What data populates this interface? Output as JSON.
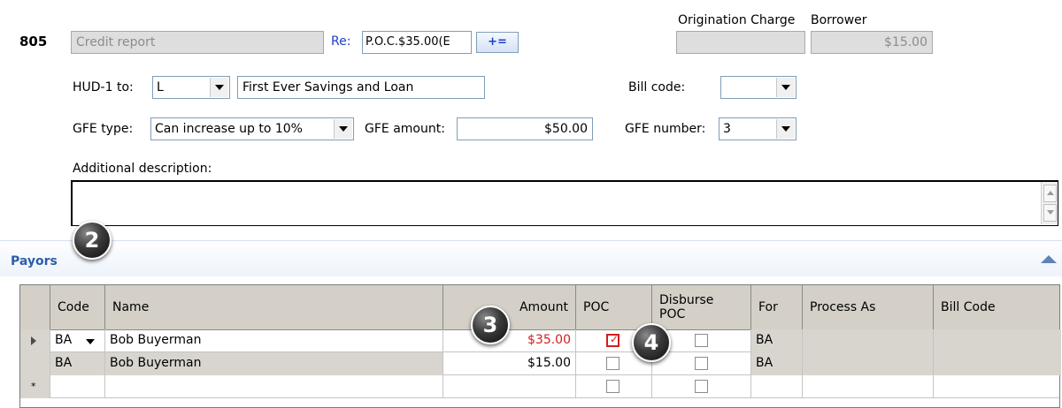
{
  "line": {
    "number": "805",
    "description": "Credit report",
    "re_label": "Re:",
    "re_value": "P.O.C.$35.00(E",
    "re_button": "+=",
    "origination_header": "Origination Charge",
    "borrower_header": "Borrower",
    "origination_value": "",
    "borrower_value": "$15.00"
  },
  "hud": {
    "label": "HUD-1 to:",
    "code": "L",
    "name": "First Ever Savings and Loan"
  },
  "bill": {
    "label": "Bill code:",
    "value": ""
  },
  "gfe": {
    "type_label": "GFE type:",
    "type_value": "Can increase up to 10%",
    "amount_label": "GFE amount:",
    "amount_value": "$50.00",
    "number_label": "GFE number:",
    "number_value": "3"
  },
  "additional": {
    "label": "Additional description:",
    "value": ""
  },
  "payors": {
    "title": "Payors",
    "columns": {
      "code": "Code",
      "name": "Name",
      "amount": "Amount",
      "poc": "POC",
      "disburse": "Disburse POC",
      "for": "For",
      "process_as": "Process As",
      "bill_code": "Bill Code"
    },
    "rows": [
      {
        "code": "BA",
        "name": "Bob Buyerman",
        "amount": "$35.00",
        "poc": true,
        "disburse": false,
        "for": "BA",
        "process_as": "",
        "bill_code": ""
      },
      {
        "code": "BA",
        "name": "Bob Buyerman",
        "amount": "$15.00",
        "poc": false,
        "disburse": false,
        "for": "BA",
        "process_as": "",
        "bill_code": ""
      }
    ],
    "new_row_marker": "*"
  },
  "callouts": [
    "2",
    "3",
    "4"
  ],
  "colors": {
    "link_blue": "#1a3fc8",
    "amount_red": "#d21e1e",
    "section_title": "#2b5ea8",
    "grid_header": "#d4d0c8"
  }
}
